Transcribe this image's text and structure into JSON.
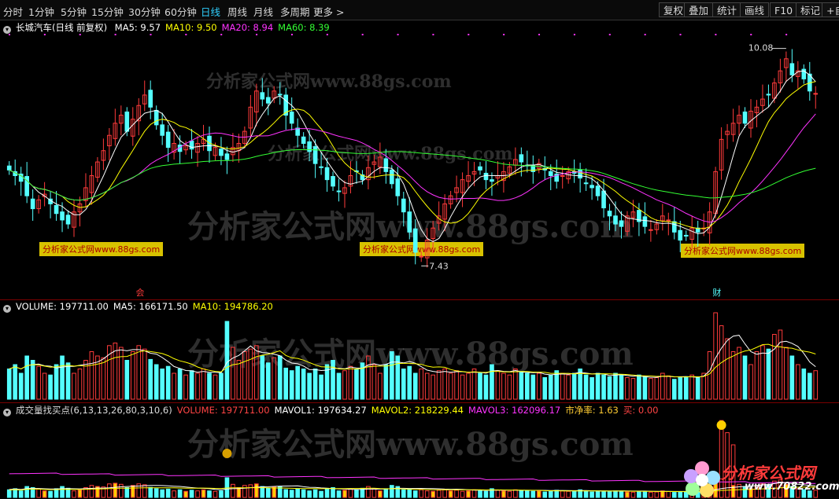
{
  "toolbar": {
    "periods": [
      "分时",
      "1分钟",
      "5分钟",
      "15分钟",
      "30分钟",
      "60分钟",
      "日线",
      "周线",
      "月线",
      "多周期",
      "更多 >"
    ],
    "active_period": "日线",
    "right_buttons": [
      "复权",
      "叠加",
      "统计",
      "画线",
      "F10",
      "标记",
      "+自"
    ]
  },
  "price_pane": {
    "title": "长城汽车(日线 前复权)",
    "ma": [
      {
        "label": "MA5: 9.57",
        "color": "#ffffff"
      },
      {
        "label": "MA10: 9.50",
        "color": "#ffff00"
      },
      {
        "label": "MA20: 8.94",
        "color": "#ff33ff"
      },
      {
        "label": "MA60: 8.39",
        "color": "#33ff33"
      }
    ],
    "high_label": "10.08",
    "low_label": "7.43",
    "markers": [
      "会",
      "财"
    ]
  },
  "volume_pane": {
    "legend": [
      {
        "label": "VOLUME: 197711.00",
        "color": "#ffffff"
      },
      {
        "label": "MA5: 166171.50",
        "color": "#ffffff"
      },
      {
        "label": "MA10: 194786.20",
        "color": "#ffff00"
      }
    ]
  },
  "indicator_pane": {
    "legend": [
      {
        "label": "成交量找买点(6,13,13,26,80,3,10,6)",
        "color": "#dddddd"
      },
      {
        "label": "VOLUME: 197711.00",
        "color": "#ff4444"
      },
      {
        "label": "MAVOL1: 197634.27",
        "color": "#ffffff"
      },
      {
        "label": "MAVOL2: 218229.44",
        "color": "#ffff00"
      },
      {
        "label": "MAVOL3: 162096.17",
        "color": "#ff33ff"
      },
      {
        "label": "市净率: 1.63",
        "color": "#ffcc33"
      },
      {
        "label": "买: 0.00",
        "color": "#ff4444"
      }
    ]
  },
  "watermarks": {
    "big": "分析家公式网www.88gs.com",
    "small": "分析家公式网www.88gs.com",
    "logo_text": "分析家公式网",
    "logo_url": "www.70822.com"
  },
  "colors": {
    "up": "#ff3b3b",
    "down": "#54ffff",
    "ma5": "#ffffff",
    "ma10": "#ffff00",
    "ma20": "#ff33ff",
    "ma60": "#33ff33"
  },
  "chart_data": {
    "type": "candlestick",
    "ylim": [
      7.2,
      10.3
    ],
    "high": 10.08,
    "low": 7.43,
    "close": [
      8.62,
      8.55,
      8.48,
      8.3,
      8.14,
      8.25,
      8.32,
      8.2,
      8.08,
      8.0,
      7.95,
      8.1,
      8.2,
      8.4,
      8.55,
      8.72,
      8.86,
      9.05,
      9.2,
      9.3,
      9.1,
      9.25,
      9.42,
      9.55,
      9.4,
      9.18,
      9.05,
      8.9,
      8.95,
      8.85,
      8.92,
      8.88,
      8.95,
      9.0,
      8.86,
      8.9,
      8.8,
      8.75,
      8.9,
      8.95,
      9.1,
      9.4,
      9.6,
      9.5,
      9.45,
      9.6,
      9.55,
      9.3,
      9.2,
      9.05,
      8.95,
      8.85,
      8.7,
      8.65,
      8.5,
      8.42,
      8.35,
      8.4,
      8.55,
      8.6,
      8.5,
      8.65,
      8.72,
      8.78,
      8.6,
      8.45,
      8.3,
      8.1,
      7.85,
      7.6,
      7.55,
      7.75,
      7.9,
      8.05,
      8.2,
      8.3,
      8.4,
      8.5,
      8.55,
      8.6,
      8.62,
      8.5,
      8.48,
      8.55,
      8.6,
      8.66,
      8.75,
      8.72,
      8.68,
      8.6,
      8.7,
      8.62,
      8.55,
      8.48,
      8.55,
      8.6,
      8.58,
      8.52,
      8.45,
      8.4,
      8.3,
      8.15,
      8.05,
      7.95,
      7.92,
      8.05,
      8.1,
      7.98,
      7.92,
      7.88,
      7.95,
      8.05,
      8.0,
      7.85,
      7.75,
      7.8,
      7.9,
      7.85,
      7.9,
      8.1,
      8.6,
      9.0,
      9.1,
      9.2,
      9.3,
      9.2,
      9.35,
      9.4,
      9.5,
      9.55,
      9.7,
      9.85,
      10.0,
      9.8,
      9.85,
      9.75,
      9.6,
      9.57
    ],
    "volume": [
      0.35,
      0.4,
      0.3,
      0.5,
      0.45,
      0.38,
      0.3,
      0.28,
      0.4,
      0.5,
      0.42,
      0.3,
      0.35,
      0.45,
      0.55,
      0.5,
      0.48,
      0.62,
      0.65,
      0.6,
      0.45,
      0.55,
      0.62,
      0.58,
      0.46,
      0.4,
      0.35,
      0.38,
      0.3,
      0.35,
      0.28,
      0.33,
      0.3,
      0.35,
      0.3,
      0.28,
      0.3,
      0.9,
      0.6,
      0.45,
      0.55,
      0.58,
      0.62,
      0.5,
      0.42,
      0.48,
      0.5,
      0.36,
      0.33,
      0.38,
      0.35,
      0.3,
      0.35,
      0.28,
      0.4,
      0.45,
      0.3,
      0.33,
      0.38,
      0.35,
      0.42,
      0.5,
      0.4,
      0.3,
      0.4,
      0.55,
      0.5,
      0.35,
      0.38,
      0.3,
      0.35,
      0.3,
      0.28,
      0.33,
      0.35,
      0.3,
      0.33,
      0.28,
      0.3,
      0.35,
      0.3,
      0.28,
      0.4,
      0.33,
      0.3,
      0.28,
      0.35,
      0.32,
      0.3,
      0.28,
      0.3,
      0.25,
      0.28,
      0.33,
      0.3,
      0.28,
      0.3,
      0.35,
      0.28,
      0.25,
      0.3,
      0.28,
      0.26,
      0.3,
      0.28,
      0.25,
      0.24,
      0.28,
      0.26,
      0.24,
      0.25,
      0.3,
      0.27,
      0.23,
      0.25,
      0.26,
      0.28,
      0.25,
      0.3,
      0.55,
      1.0,
      0.85,
      0.7,
      0.55,
      0.6,
      0.5,
      0.4,
      0.55,
      0.62,
      0.58,
      0.75,
      0.8,
      0.6,
      0.5,
      0.4,
      0.35,
      0.3,
      0.33
    ]
  }
}
